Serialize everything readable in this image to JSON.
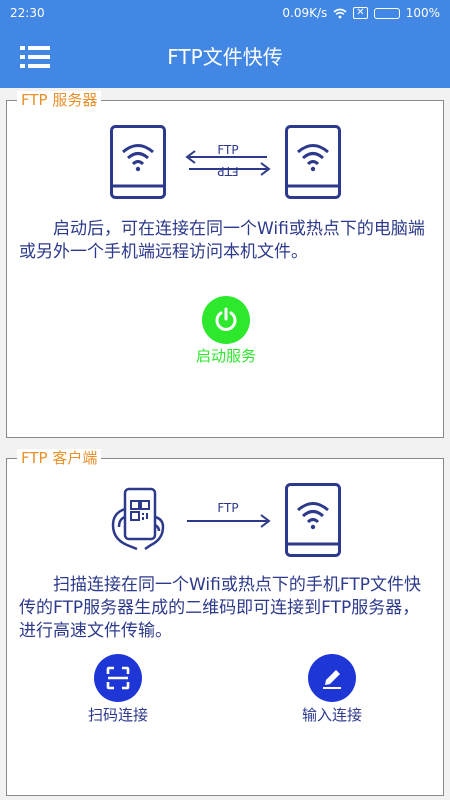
{
  "status_bar": {
    "time": "22:30",
    "speed": "0.09K/s",
    "battery": "100%",
    "battery_level": 1.0
  },
  "app_bar": {
    "title": "FTP文件快传"
  },
  "server_panel": {
    "legend": "FTP 服务器",
    "arrow_label_top": "FTP",
    "arrow_label_bottom": "FTP",
    "description": "启动后，可在连接在同一个Wifi或热点下的电脑端或另外一个手机端远程访问本机文件。",
    "start_button_label": "启动服务",
    "start_button_color": "#2ee82e"
  },
  "client_panel": {
    "legend": "FTP 客户端",
    "arrow_label": "FTP",
    "description": "扫描连接在同一个Wifi或热点下的手机FTP文件快传的FTP服务器生成的二维码即可连接到FTP服务器，进行高速文件传输。",
    "scan_button_label": "扫码连接",
    "input_button_label": "输入连接",
    "button_color": "#1f36d6"
  },
  "colors": {
    "primary": "#4287e4",
    "legend": "#e8912a",
    "icon_navy": "#2d3a8c"
  }
}
